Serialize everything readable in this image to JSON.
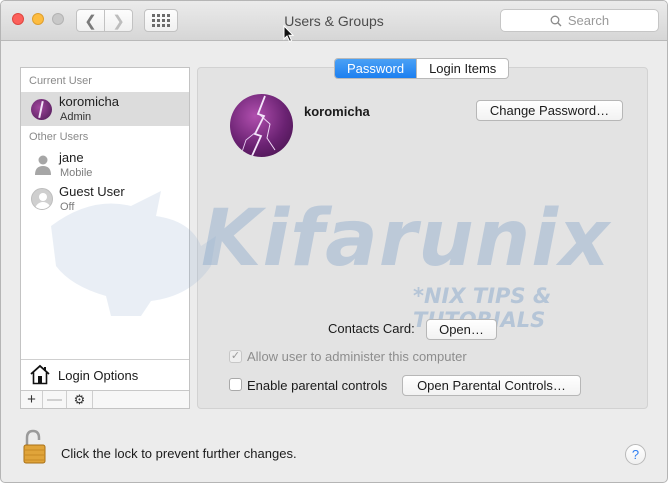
{
  "window": {
    "title": "Users & Groups",
    "search_placeholder": "Search"
  },
  "sidebar": {
    "current_user_header": "Current User",
    "other_users_header": "Other Users",
    "current_user": {
      "name": "koromicha",
      "role": "Admin"
    },
    "other_users": [
      {
        "name": "jane",
        "role": "Mobile"
      },
      {
        "name": "Guest User",
        "role": "Off"
      }
    ],
    "login_options_label": "Login Options",
    "toolbar": {
      "add": "+",
      "remove": "—"
    }
  },
  "tabs": [
    {
      "label": "Password",
      "active": true
    },
    {
      "label": "Login Items",
      "active": false
    }
  ],
  "main": {
    "username": "koromicha",
    "change_password_button": "Change Password…",
    "contacts_card_label": "Contacts Card:",
    "open_button": "Open…",
    "admin_checkbox_label": "Allow user to administer this computer",
    "admin_checkbox_checked": true,
    "admin_checkbox_disabled": true,
    "parental_checkbox_label": "Enable parental controls",
    "parental_checkbox_checked": false,
    "open_parental_button": "Open Parental Controls…"
  },
  "watermark": {
    "brand": "Kifarunix",
    "tagline": "*NIX TIPS & TUTORIALS"
  },
  "footer": {
    "lock_text": "Click the lock to prevent further changes.",
    "help": "?"
  },
  "colors": {
    "accent": "#1c7ff0",
    "close": "#fc605b",
    "minimize": "#fdbc40"
  }
}
